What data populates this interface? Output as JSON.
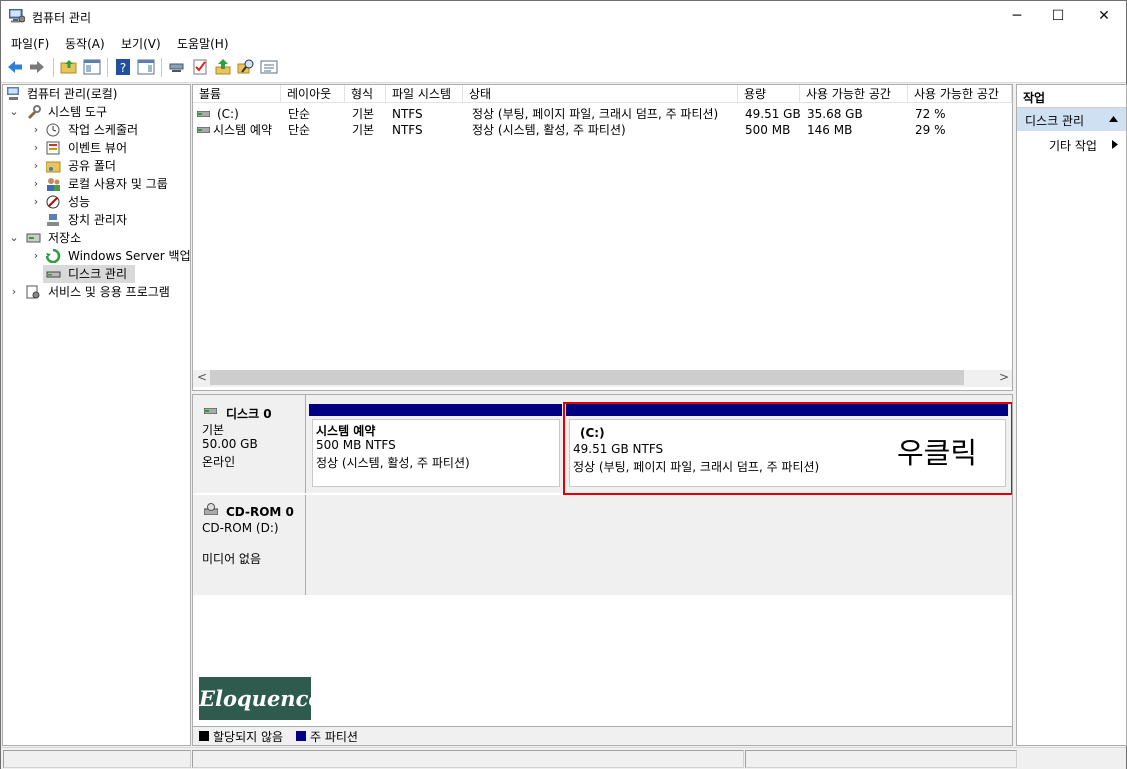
{
  "window": {
    "title": "컴퓨터 관리",
    "minimize": "─",
    "maximize": "☐",
    "close": "✕"
  },
  "menu": [
    "파일(F)",
    "동작(A)",
    "보기(V)",
    "도움말(H)"
  ],
  "tree": {
    "root": "컴퓨터 관리(로컬)",
    "system_tools": "시스템 도구",
    "task_scheduler": "작업 스케줄러",
    "event_viewer": "이벤트 뷰어",
    "shared_folders": "공유 폴더",
    "local_users": "로컬 사용자 및 그룹",
    "performance": "성능",
    "device_manager": "장치 관리자",
    "storage": "저장소",
    "windows_backup": "Windows Server 백업",
    "disk_management": "디스크 관리",
    "services_apps": "서비스 및 응용 프로그램"
  },
  "volume_list": {
    "headers": [
      "볼륨",
      "레이아웃",
      "형식",
      "파일 시스템",
      "상태",
      "용량",
      "사용 가능한 공간",
      "사용 가능한 공간"
    ],
    "rows": [
      [
        "(C:)",
        "단순",
        "기본",
        "NTFS",
        "정상 (부팅, 페이지 파일, 크래시 덤프, 주 파티션)",
        "49.51 GB",
        "35.68 GB",
        "72 %"
      ],
      [
        "시스템 예약",
        "단순",
        "기본",
        "NTFS",
        "정상 (시스템, 활성, 주 파티션)",
        "500 MB",
        "146 MB",
        "29 %"
      ]
    ],
    "scroll_left": "<",
    "scroll_right": ">"
  },
  "disk0": {
    "name": "디스크 0",
    "type": "기본",
    "size": "50.00 GB",
    "status": "온라인",
    "partitions": [
      {
        "name": "시스템 예약",
        "size": "500 MB NTFS",
        "status": "정상 (시스템, 활성, 주 파티션)"
      },
      {
        "name": "(C:)",
        "size": "49.51 GB NTFS",
        "status": "정상 (부팅, 페이지 파일, 크래시 덤프, 주 파티션)"
      }
    ],
    "annotation": "우클릭"
  },
  "cdrom0": {
    "name": "CD-ROM 0",
    "drive": "CD-ROM (D:)",
    "media": "미디어 없음"
  },
  "watermark": "Eloquence",
  "legend": {
    "unallocated": "할당되지 않음",
    "primary": "주 파티션",
    "unallocated_color": "#000000",
    "primary_color": "#000080"
  },
  "actions": {
    "header": "작업",
    "section": "디스크 관리",
    "more": "기타 작업"
  },
  "colors": {
    "partition_bar": "#000080",
    "highlight_box": "#e00000",
    "watermark_bg": "#2f5b4f"
  }
}
